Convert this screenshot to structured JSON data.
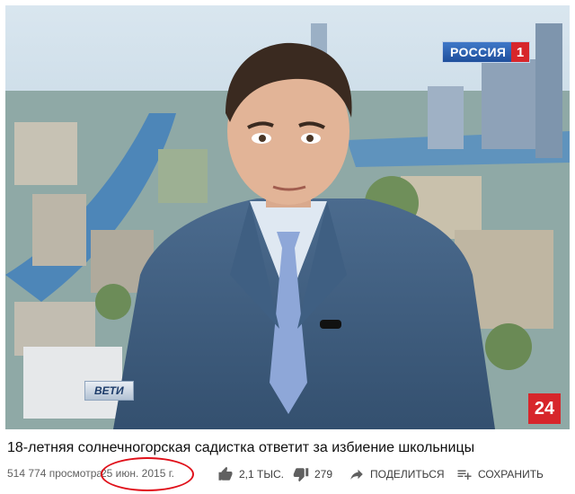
{
  "video": {
    "channel_logo": "РОССИЯ",
    "channel_logo_number": "1",
    "corner_badge": "24",
    "lower_logo": "ВЕТИ"
  },
  "title": "18-летняя солнечногорская садистка ответит за избиение школьницы",
  "meta": {
    "views": "514 774 просмотра",
    "date": "25 июн. 2015 г."
  },
  "actions": {
    "like_count": "2,1 ТЫС.",
    "dislike_count": "279",
    "share_label": "ПОДЕЛИТЬСЯ",
    "save_label": "СОХРАНИТЬ"
  },
  "colors": {
    "annotation_circle": "#e0101a",
    "channel_red": "#d7262b"
  },
  "icons": [
    "thumb-up-icon",
    "thumb-down-icon",
    "share-icon",
    "save-playlist-icon"
  ]
}
